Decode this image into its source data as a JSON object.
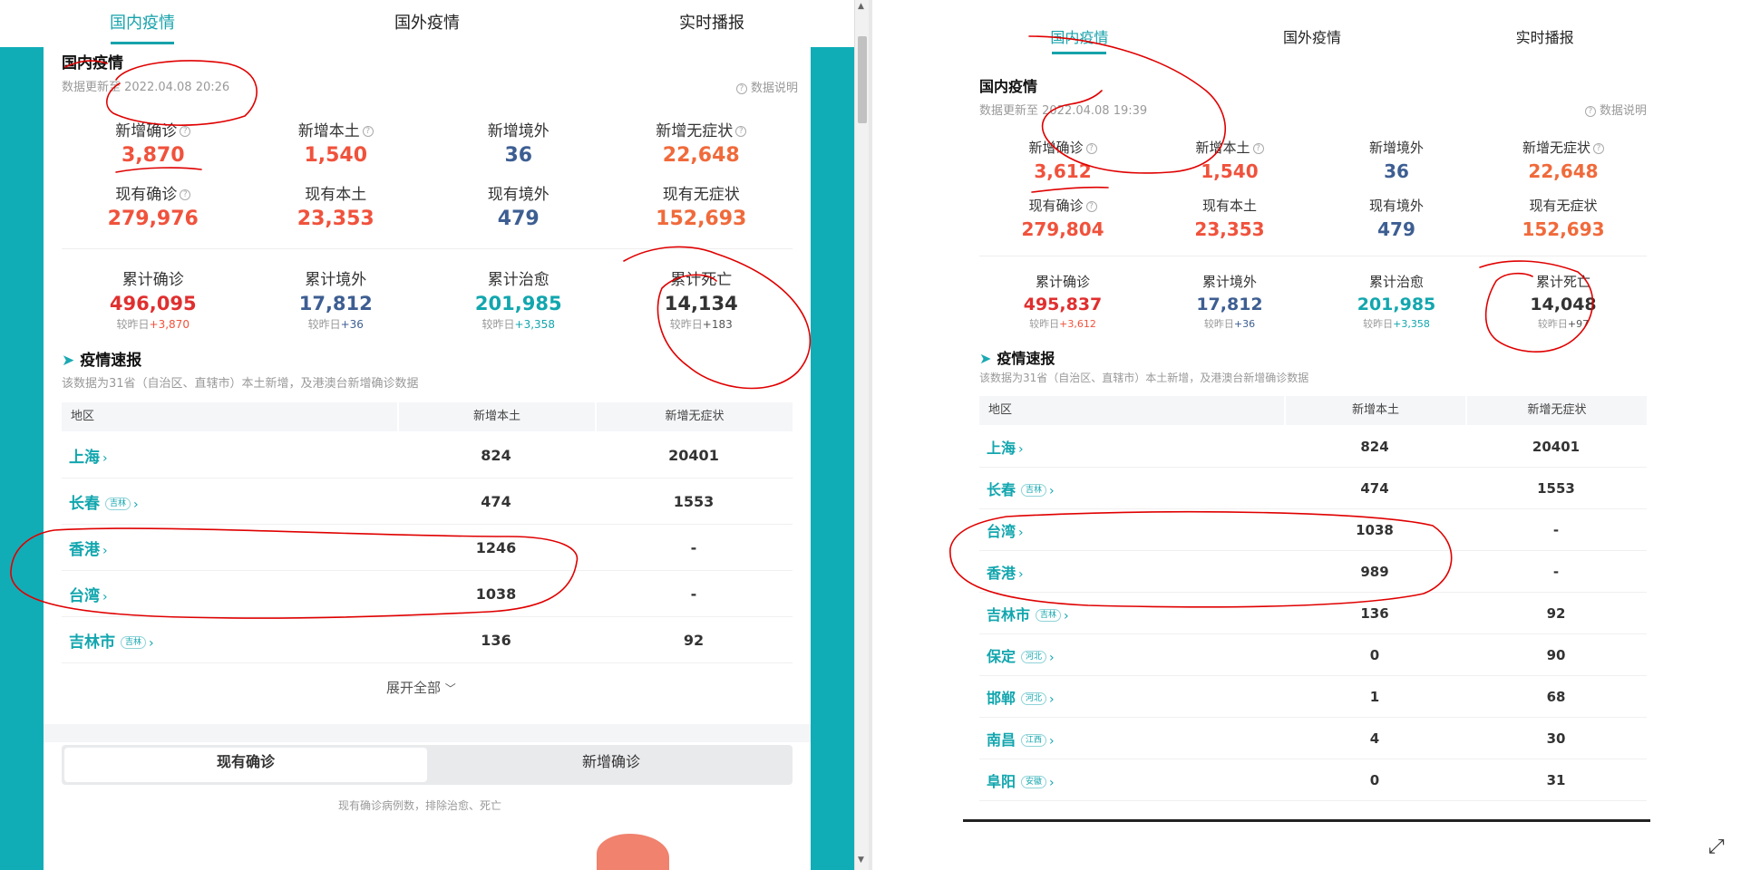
{
  "tabs": [
    "国内疫情",
    "国外疫情",
    "实时播报"
  ],
  "left": {
    "section_title": "国内疫情",
    "update_time": "数据更新至 2022.04.08 20:26",
    "explain": "数据说明",
    "new_stats": [
      {
        "label": "新增确诊",
        "value": "3,870"
      },
      {
        "label": "新增本土",
        "value": "1,540"
      },
      {
        "label": "新增境外",
        "value": "36"
      },
      {
        "label": "新增无症状",
        "value": "22,648"
      }
    ],
    "current_stats": [
      {
        "label": "现有确诊",
        "value": "279,976"
      },
      {
        "label": "现有本土",
        "value": "23,353"
      },
      {
        "label": "现有境外",
        "value": "479"
      },
      {
        "label": "现有无症状",
        "value": "152,693"
      }
    ],
    "cumulative": [
      {
        "label": "累计确诊",
        "value": "496,095",
        "sub_prefix": "较昨日",
        "sub_value": "+3,870"
      },
      {
        "label": "累计境外",
        "value": "17,812",
        "sub_prefix": "较昨日",
        "sub_value": "+36"
      },
      {
        "label": "累计治愈",
        "value": "201,985",
        "sub_prefix": "较昨日",
        "sub_value": "+3,358"
      },
      {
        "label": "累计死亡",
        "value": "14,134",
        "sub_prefix": "较昨日",
        "sub_value": "+183"
      }
    ],
    "report_title": "疫情速报",
    "report_desc": "该数据为31省（自治区、直辖市）本土新增，及港澳台新增确诊数据",
    "table_headers": [
      "地区",
      "新增本土",
      "新增无症状"
    ],
    "rows": [
      {
        "region": "上海",
        "tag": "",
        "local": "824",
        "asym": "20401"
      },
      {
        "region": "长春",
        "tag": "吉林",
        "local": "474",
        "asym": "1553"
      },
      {
        "region": "香港",
        "tag": "",
        "local": "1246",
        "asym": "-"
      },
      {
        "region": "台湾",
        "tag": "",
        "local": "1038",
        "asym": "-"
      },
      {
        "region": "吉林市",
        "tag": "吉林",
        "local": "136",
        "asym": "92"
      }
    ],
    "expand_label": "展开全部",
    "segment": [
      "现有确诊",
      "新增确诊"
    ],
    "segment_note": "现有确诊病例数，排除治愈、死亡"
  },
  "right": {
    "section_title": "国内疫情",
    "update_time": "数据更新至 2022.04.08 19:39",
    "explain": "数据说明",
    "new_stats": [
      {
        "label": "新增确诊",
        "value": "3,612"
      },
      {
        "label": "新增本土",
        "value": "1,540"
      },
      {
        "label": "新增境外",
        "value": "36"
      },
      {
        "label": "新增无症状",
        "value": "22,648"
      }
    ],
    "current_stats": [
      {
        "label": "现有确诊",
        "value": "279,804"
      },
      {
        "label": "现有本土",
        "value": "23,353"
      },
      {
        "label": "现有境外",
        "value": "479"
      },
      {
        "label": "现有无症状",
        "value": "152,693"
      }
    ],
    "cumulative": [
      {
        "label": "累计确诊",
        "value": "495,837",
        "sub_prefix": "较昨日",
        "sub_value": "+3,612"
      },
      {
        "label": "累计境外",
        "value": "17,812",
        "sub_prefix": "较昨日",
        "sub_value": "+36"
      },
      {
        "label": "累计治愈",
        "value": "201,985",
        "sub_prefix": "较昨日",
        "sub_value": "+3,358"
      },
      {
        "label": "累计死亡",
        "value": "14,048",
        "sub_prefix": "较昨日",
        "sub_value": "+97"
      }
    ],
    "report_title": "疫情速报",
    "report_desc": "该数据为31省（自治区、直辖市）本土新增，及港澳台新增确诊数据",
    "table_headers": [
      "地区",
      "新增本土",
      "新增无症状"
    ],
    "rows": [
      {
        "region": "上海",
        "tag": "",
        "local": "824",
        "asym": "20401"
      },
      {
        "region": "长春",
        "tag": "吉林",
        "local": "474",
        "asym": "1553"
      },
      {
        "region": "台湾",
        "tag": "",
        "local": "1038",
        "asym": "-"
      },
      {
        "region": "香港",
        "tag": "",
        "local": "989",
        "asym": "-"
      },
      {
        "region": "吉林市",
        "tag": "吉林",
        "local": "136",
        "asym": "92"
      },
      {
        "region": "保定",
        "tag": "河北",
        "local": "0",
        "asym": "90"
      },
      {
        "region": "邯郸",
        "tag": "河北",
        "local": "1",
        "asym": "68"
      },
      {
        "region": "南昌",
        "tag": "江西",
        "local": "4",
        "asym": "30"
      },
      {
        "region": "阜阳",
        "tag": "安徽",
        "local": "0",
        "asym": "31"
      }
    ]
  },
  "colors": {
    "accent": "#11adb7",
    "confirmed": "#f0523c",
    "imported": "#3d5e92",
    "asymptomatic": "#f06a3b",
    "cured": "#12a6ae",
    "annotation": "#e00000"
  }
}
